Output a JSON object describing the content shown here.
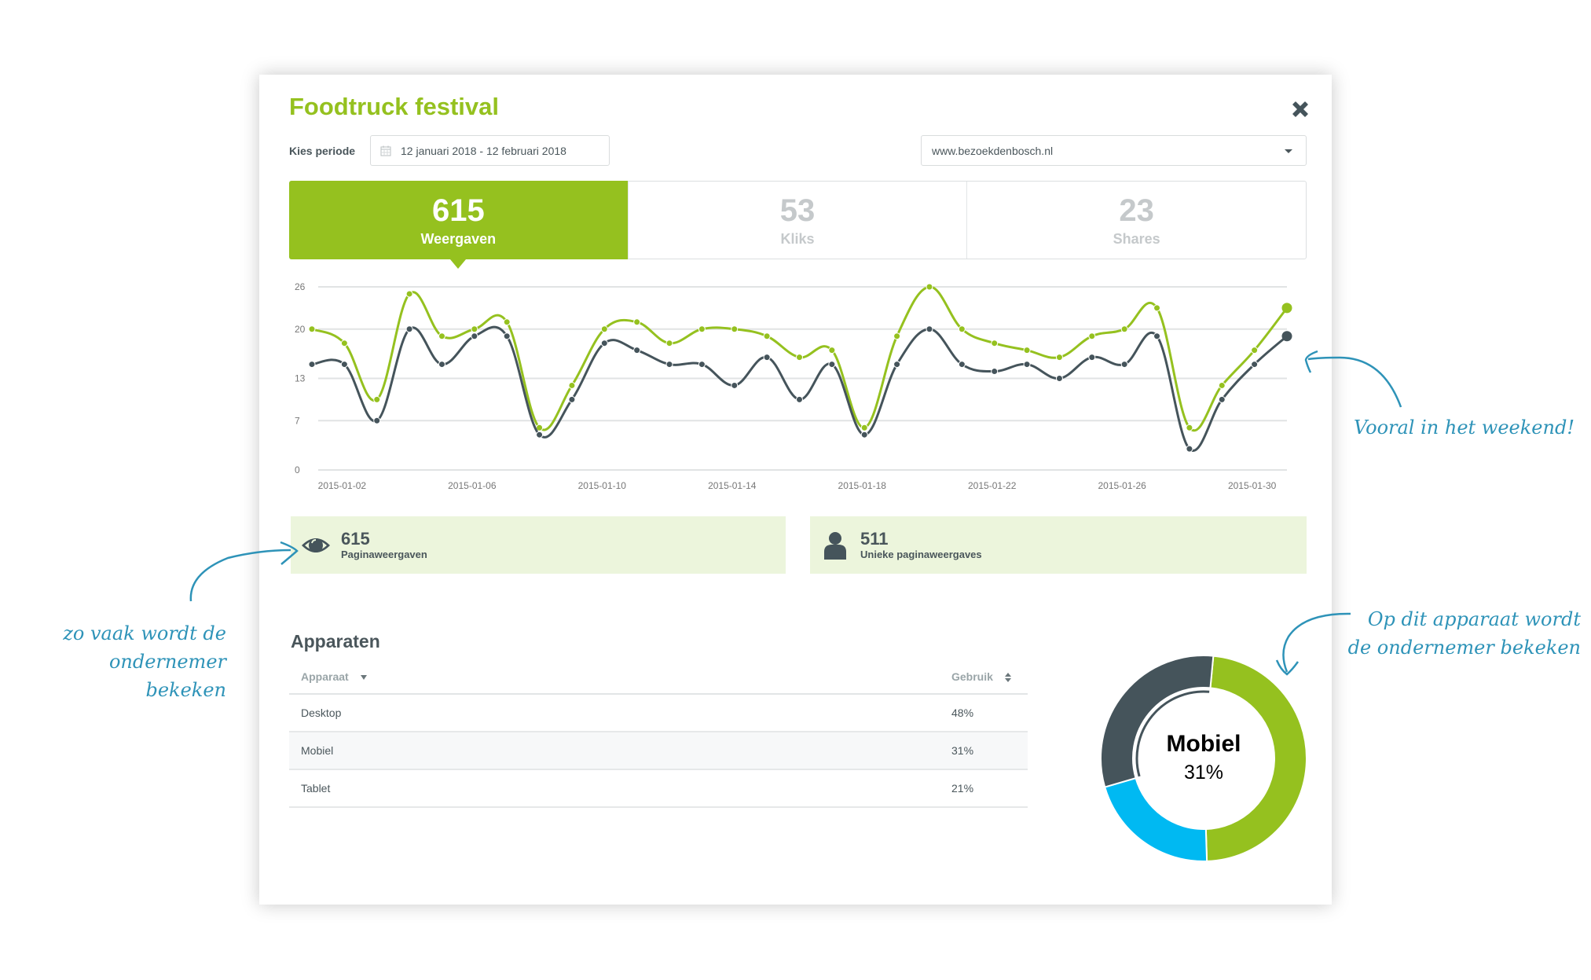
{
  "header": {
    "title": "Foodtruck festival",
    "close_icon": "close-icon"
  },
  "filters": {
    "period_label": "Kies periode",
    "period_icon": "calendar-icon",
    "period_value": "12 januari 2018 - 12 februari 2018",
    "site_value": "www.bezoekdenbosch.nl",
    "site_icon": "chevron-down-icon"
  },
  "tabs": [
    {
      "value": "615",
      "label": "Weergaven",
      "active": true
    },
    {
      "value": "53",
      "label": "Kliks",
      "active": false
    },
    {
      "value": "23",
      "label": "Shares",
      "active": false
    }
  ],
  "colors": {
    "brand_green": "#95c11f",
    "dark_slate": "#45545b",
    "cyan": "#00b9f2",
    "annotation_blue": "#2e93b8",
    "summary_bg": "#ecf5dc"
  },
  "chart_data": [
    {
      "type": "line",
      "title": "",
      "xlabel": "",
      "ylabel": "",
      "x": [
        "2015-01-01",
        "2015-01-02",
        "2015-01-03",
        "2015-01-04",
        "2015-01-05",
        "2015-01-06",
        "2015-01-07",
        "2015-01-08",
        "2015-01-09",
        "2015-01-10",
        "2015-01-11",
        "2015-01-12",
        "2015-01-13",
        "2015-01-14",
        "2015-01-15",
        "2015-01-16",
        "2015-01-17",
        "2015-01-18",
        "2015-01-19",
        "2015-01-20",
        "2015-01-21",
        "2015-01-22",
        "2015-01-23",
        "2015-01-24",
        "2015-01-25",
        "2015-01-26",
        "2015-01-27",
        "2015-01-28",
        "2015-01-29",
        "2015-01-30",
        "2015-01-31"
      ],
      "x_tick_labels": [
        "2015-01-02",
        "2015-01-06",
        "2015-01-10",
        "2015-01-14",
        "2015-01-18",
        "2015-01-22",
        "2015-01-26",
        "2015-01-30"
      ],
      "y_ticks": [
        0,
        7,
        13,
        20,
        26
      ],
      "ylim": [
        0,
        26
      ],
      "grid": true,
      "series": [
        {
          "name": "Weergaven",
          "color": "#95c11f",
          "values": [
            20,
            18,
            10,
            25,
            19,
            20,
            21,
            6,
            12,
            20,
            21,
            18,
            20,
            20,
            19,
            16,
            17,
            6,
            19,
            26,
            20,
            18,
            17,
            16,
            19,
            20,
            23,
            6,
            12,
            17,
            23
          ]
        },
        {
          "name": "Unieke weergaven",
          "color": "#45545b",
          "values": [
            15,
            15,
            7,
            20,
            15,
            19,
            19,
            5,
            10,
            18,
            17,
            15,
            15,
            12,
            16,
            10,
            15,
            5,
            15,
            20,
            15,
            14,
            15,
            13,
            16,
            15,
            19,
            3,
            10,
            15,
            19
          ]
        }
      ]
    },
    {
      "type": "pie",
      "title": "Apparaten",
      "center_label": "Mobiel",
      "center_value": "31%",
      "highlighted": "Mobiel",
      "slices": [
        {
          "name": "Desktop",
          "value": 48,
          "color": "#95c11f"
        },
        {
          "name": "Tablet",
          "value": 21,
          "color": "#00b9f2"
        },
        {
          "name": "Mobiel",
          "value": 31,
          "color": "#45545b"
        }
      ]
    }
  ],
  "summary": [
    {
      "icon": "eye-icon",
      "value": "615",
      "label": "Paginaweergaven"
    },
    {
      "icon": "user-icon",
      "value": "511",
      "label": "Unieke paginaweergaves"
    }
  ],
  "devices": {
    "title": "Apparaten",
    "columns": [
      {
        "label": "Apparaat",
        "sort_icon": "caret-down-icon"
      },
      {
        "label": "Gebruik",
        "sort_icon": "sort-icon"
      }
    ],
    "rows": [
      {
        "device": "Desktop",
        "usage": "48%"
      },
      {
        "device": "Mobiel",
        "usage": "31%"
      },
      {
        "device": "Tablet",
        "usage": "21%"
      }
    ]
  },
  "annotations": {
    "weekend": "Vooral in het weekend!",
    "views_line1": "zo vaak wordt de",
    "views_line2": "ondernemer bekeken",
    "device_line1": "Op dit apparaat wordt",
    "device_line2": "de ondernemer bekeken"
  }
}
